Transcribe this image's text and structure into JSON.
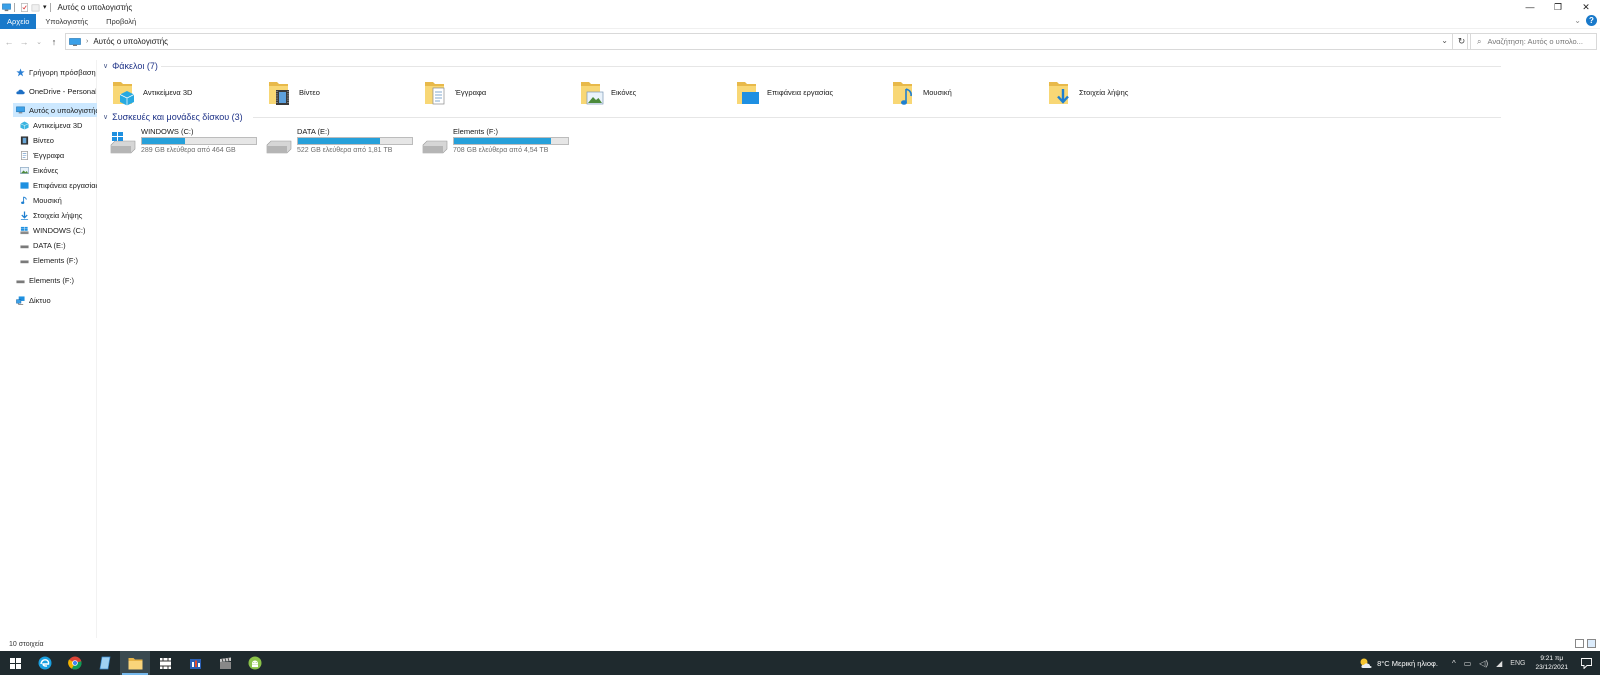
{
  "window": {
    "title": "Αυτός ο υπολογιστής",
    "controls": {
      "minimize": "—",
      "restore": "❐",
      "close": "✕"
    }
  },
  "ribbon": {
    "tabs": [
      {
        "label": "Αρχείο",
        "active": true
      },
      {
        "label": "Υπολογιστής",
        "active": false
      },
      {
        "label": "Προβολή",
        "active": false
      }
    ],
    "help": "?",
    "collapse": "⌄"
  },
  "address": {
    "back": "←",
    "forward": "→",
    "recent": "⌄",
    "up": "↑",
    "path_separator": "›",
    "path": "Αυτός ο υπολογιστής",
    "dropdown": "⌄",
    "refresh": "↻",
    "search_placeholder": "Αναζήτηση: Αυτός ο υπολο..."
  },
  "nav": {
    "items": [
      {
        "label": "Γρήγορη πρόσβαση",
        "icon": "star-icon"
      },
      {
        "label": "OneDrive - Personal",
        "icon": "cloud-icon"
      },
      {
        "label": "Αυτός ο υπολογιστής",
        "icon": "computer-icon",
        "selected": true
      },
      {
        "label": "Αντικείμενα 3D",
        "icon": "cube-icon"
      },
      {
        "label": "Βίντεο",
        "icon": "video-icon"
      },
      {
        "label": "Έγγραφα",
        "icon": "document-icon"
      },
      {
        "label": "Εικόνες",
        "icon": "picture-icon"
      },
      {
        "label": "Επιφάνεια εργασίας",
        "icon": "desktop-icon"
      },
      {
        "label": "Μουσική",
        "icon": "music-icon"
      },
      {
        "label": "Στοιχεία λήψης",
        "icon": "download-icon"
      },
      {
        "label": "WINDOWS (C:)",
        "icon": "windows-drive-icon"
      },
      {
        "label": "DATA (E:)",
        "icon": "drive-icon"
      },
      {
        "label": "Elements (F:)",
        "icon": "drive-icon"
      },
      {
        "label": "Elements (F:)",
        "icon": "drive-icon"
      },
      {
        "label": "Δίκτυο",
        "icon": "network-icon"
      }
    ]
  },
  "folders_group": {
    "title": "Φάκελοι (7)",
    "items": [
      {
        "label": "Αντικείμενα 3D",
        "icon": "folder-3d-objects-icon"
      },
      {
        "label": "Βίντεο",
        "icon": "folder-videos-icon"
      },
      {
        "label": "Έγγραφα",
        "icon": "folder-documents-icon"
      },
      {
        "label": "Εικόνες",
        "icon": "folder-pictures-icon"
      },
      {
        "label": "Επιφάνεια εργασίας",
        "icon": "folder-desktop-icon"
      },
      {
        "label": "Μουσική",
        "icon": "folder-music-icon"
      },
      {
        "label": "Στοιχεία λήψης",
        "icon": "folder-downloads-icon"
      }
    ]
  },
  "drives_group": {
    "title": "Συσκευές και μονάδες δίσκου (3)",
    "items": [
      {
        "name": "WINDOWS (C:)",
        "free_text": "289 GB ελεύθερα από 464 GB",
        "used_fraction": 0.377,
        "icon": "windows-drive-icon"
      },
      {
        "name": "DATA (E:)",
        "free_text": "522 GB ελεύθερα από 1,81 TB",
        "used_fraction": 0.718,
        "icon": "drive-icon"
      },
      {
        "name": "Elements (F:)",
        "free_text": "708 GB ελεύθερα από 4,54 TB",
        "used_fraction": 0.848,
        "icon": "drive-icon"
      }
    ]
  },
  "status": {
    "count": "10 στοιχεία"
  },
  "taskbar": {
    "apps": [
      "windows-start-icon",
      "edge-icon",
      "chrome-icon",
      "notepad-icon",
      "file-explorer-icon",
      "movie-maker-icon",
      "office-icon",
      "clapper-icon",
      "android-icon"
    ],
    "active_app": "file-explorer-icon",
    "weather": "8°C  Μερική ηλιοφ.",
    "language": "ENG",
    "time": "9:21 πμ",
    "date": "23/12/2021",
    "tray_arrow": "^"
  },
  "colors": {
    "accent": "#1979ca",
    "drive_fill": "#26a0da",
    "selected_nav": "#cce8ff",
    "group_header": "#1e3287",
    "taskbar": "#1f2a2e"
  }
}
